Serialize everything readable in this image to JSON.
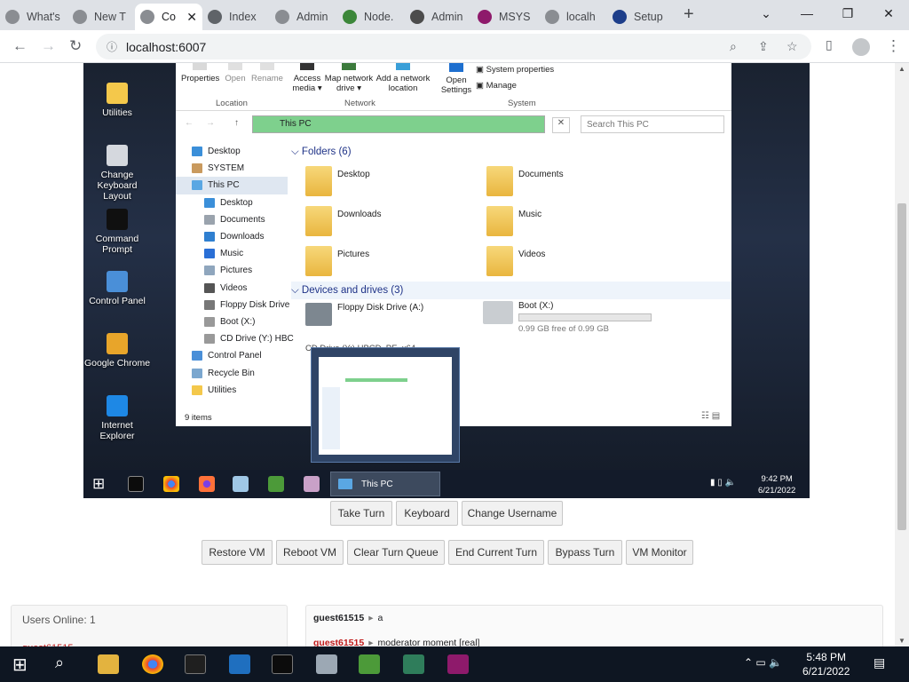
{
  "browser": {
    "tabs": [
      {
        "title": "What's",
        "color": "#8a8d92"
      },
      {
        "title": "New T",
        "color": "#8a8d92"
      },
      {
        "title": "Co",
        "color": "#8a8d92",
        "active": true
      },
      {
        "title": "Index",
        "color": "#5f6368"
      },
      {
        "title": "Admin",
        "color": "#8a8d92"
      },
      {
        "title": "Node.",
        "color": "#3c873a"
      },
      {
        "title": "Admin",
        "color": "#4c4c4c"
      },
      {
        "title": "MSYS",
        "color": "#8e1a6b"
      },
      {
        "title": "localh",
        "color": "#8a8d92"
      },
      {
        "title": "Setup",
        "color": "#1d3e8a"
      }
    ],
    "new_tab": "+",
    "url": "localhost:6007"
  },
  "vm": {
    "desktop_icons": [
      {
        "label": "Utilities",
        "color": "#f4c84b"
      },
      {
        "label": "Change Keyboard Layout",
        "color": "#d5d8de"
      },
      {
        "label": "Command Prompt",
        "color": "#101010"
      },
      {
        "label": "Control Panel",
        "color": "#4a8fd8"
      },
      {
        "label": "Google Chrome",
        "color": "#e8a52a"
      },
      {
        "label": "Internet Explorer",
        "color": "#1e88e5"
      }
    ],
    "explorer": {
      "ribbon": {
        "properties": "Properties",
        "open": "Open",
        "rename": "Rename",
        "access_media": "Access media ▾",
        "map_network_drive": "Map network drive ▾",
        "add_network_location": "Add a network location",
        "open_settings": "Open Settings",
        "system_properties": "System properties",
        "manage": "Manage",
        "groups": [
          "Location",
          "Network",
          "System"
        ]
      },
      "path": "This PC",
      "search_placeholder": "Search This PC",
      "nav_items": [
        {
          "label": "Desktop",
          "indent": 0,
          "color": "#3b8fd9"
        },
        {
          "label": "SYSTEM",
          "indent": 0,
          "color": "#c99a5e"
        },
        {
          "label": "This PC",
          "indent": 0,
          "color": "#5aa7e3",
          "selected": true
        },
        {
          "label": "Desktop",
          "indent": 1,
          "color": "#3b8fd9"
        },
        {
          "label": "Documents",
          "indent": 1,
          "color": "#9aa3ad"
        },
        {
          "label": "Downloads",
          "indent": 1,
          "color": "#2f7fd0"
        },
        {
          "label": "Music",
          "indent": 1,
          "color": "#2a6fd6"
        },
        {
          "label": "Pictures",
          "indent": 1,
          "color": "#8fa6bd"
        },
        {
          "label": "Videos",
          "indent": 1,
          "color": "#555"
        },
        {
          "label": "Floppy Disk Drive",
          "indent": 1,
          "color": "#777"
        },
        {
          "label": "Boot (X:)",
          "indent": 1,
          "color": "#999"
        },
        {
          "label": "CD Drive (Y:) HBC",
          "indent": 1,
          "color": "#999"
        },
        {
          "label": "Control Panel",
          "indent": 0,
          "color": "#4a8fd8"
        },
        {
          "label": "Recycle Bin",
          "indent": 0,
          "color": "#7ba7cf"
        },
        {
          "label": "Utilities",
          "indent": 0,
          "color": "#f4c84b"
        }
      ],
      "folders_header": "Folders (6)",
      "folders": [
        "Desktop",
        "Documents",
        "Downloads",
        "Music",
        "Pictures",
        "Videos"
      ],
      "devices_header": "Devices and drives (3)",
      "floppy": "Floppy Disk Drive (A:)",
      "boot_drive": {
        "name": "Boot (X:)",
        "free_text": "0.99 GB free of 0.99 GB",
        "used_fraction": 0.0
      },
      "cd_drive": "CD Drive (Y:) HBCD_PE_x64",
      "status": "9 items"
    },
    "taskbar": {
      "active_window": "This PC",
      "time": "9:42 PM",
      "date": "6/21/2022"
    }
  },
  "controls": {
    "row1": [
      "Take Turn",
      "Keyboard",
      "Change Username"
    ],
    "row2": [
      "Restore VM",
      "Reboot VM",
      "Clear Turn Queue",
      "End Current Turn",
      "Bypass Turn",
      "VM Monitor"
    ]
  },
  "users_panel": {
    "title": "Users Online: 1",
    "user": "guest61515"
  },
  "chat": [
    {
      "user": "guest61515",
      "sep": "▸",
      "message": "a",
      "color": "#202124"
    },
    {
      "user": "guest61515",
      "sep": "▸",
      "message": "moderator moment [real]",
      "color": "#c01c1c"
    }
  ],
  "host_taskbar": {
    "time": "5:48 PM",
    "date": "6/21/2022"
  }
}
